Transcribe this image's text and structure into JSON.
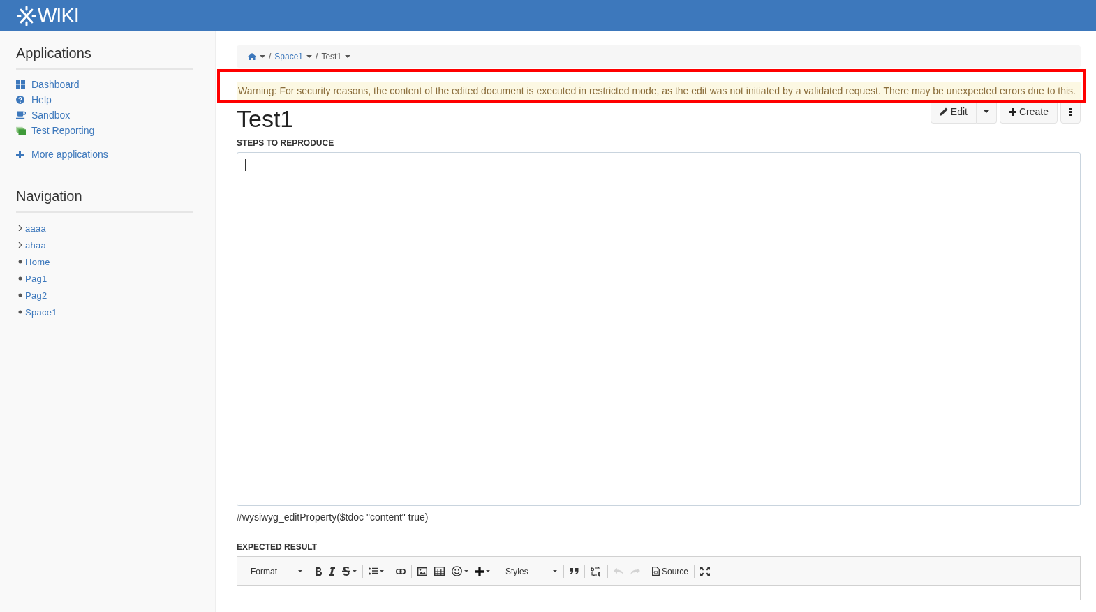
{
  "header": {
    "logo": "WIKI"
  },
  "sidebar": {
    "applications": {
      "title": "Applications",
      "items": [
        {
          "kind": "dashboard",
          "label": "Dashboard"
        },
        {
          "kind": "help",
          "label": "Help"
        },
        {
          "kind": "sandbox",
          "label": "Sandbox"
        },
        {
          "kind": "reporting",
          "label": "Test Reporting"
        }
      ],
      "more": "More applications"
    },
    "navigation": {
      "title": "Navigation",
      "items": [
        {
          "label": "aaaa",
          "expandable": true
        },
        {
          "label": "ahaa",
          "expandable": true
        },
        {
          "label": "Home",
          "expandable": false
        },
        {
          "label": "Pag1",
          "expandable": false
        },
        {
          "label": "Pag2",
          "expandable": false
        },
        {
          "label": "Space1",
          "expandable": false
        }
      ]
    }
  },
  "breadcrumb": [
    {
      "kind": "home"
    },
    {
      "kind": "separator",
      "label": "/"
    },
    {
      "kind": "link",
      "label": "Space1"
    },
    {
      "kind": "separator",
      "label": "/"
    },
    {
      "kind": "current",
      "label": "Test1"
    }
  ],
  "warning": "Warning: For security reasons, the content of the edited document is executed in restricted mode, as the edit was not initiated by a validated request. There may be unexpected errors due to this.",
  "page_title": "Test1",
  "actions": {
    "edit": "Edit",
    "create": "Create"
  },
  "fields": [
    {
      "label": "STEPS TO REPRODUCE"
    }
  ],
  "macro_text": "#wysiwyg_editProperty($tdoc \"content\" true)",
  "expected": {
    "label": "EXPECTED RESULT",
    "toolbar": [
      {
        "kind": "dropdown",
        "label": "Format",
        "caret": true,
        "disabled": false
      },
      {
        "kind": "sep"
      },
      {
        "kind": "bold",
        "caret": false,
        "disabled": false
      },
      {
        "kind": "italic",
        "caret": false,
        "disabled": false
      },
      {
        "kind": "strike",
        "caret": true,
        "disabled": false
      },
      {
        "kind": "sep"
      },
      {
        "kind": "list",
        "caret": true,
        "disabled": false
      },
      {
        "kind": "sep"
      },
      {
        "kind": "link",
        "caret": false,
        "disabled": false
      },
      {
        "kind": "sep"
      },
      {
        "kind": "image",
        "caret": false,
        "disabled": false
      },
      {
        "kind": "table",
        "caret": false,
        "disabled": false
      },
      {
        "kind": "emoji",
        "caret": true,
        "disabled": false
      },
      {
        "kind": "plus",
        "caret": true,
        "disabled": false
      },
      {
        "kind": "sep"
      },
      {
        "kind": "dropdown",
        "label": "Styles",
        "caret": true,
        "disabled": false
      },
      {
        "kind": "sep"
      },
      {
        "kind": "quote",
        "caret": false,
        "disabled": false
      },
      {
        "kind": "sep"
      },
      {
        "kind": "replace",
        "caret": false,
        "disabled": false
      },
      {
        "kind": "sep"
      },
      {
        "kind": "undo",
        "caret": false,
        "disabled": true
      },
      {
        "kind": "redo",
        "caret": false,
        "disabled": true
      },
      {
        "kind": "sep"
      },
      {
        "kind": "source",
        "label": "Source",
        "caret": false,
        "disabled": false
      },
      {
        "kind": "sep"
      },
      {
        "kind": "maximize",
        "caret": false,
        "disabled": false
      },
      {
        "kind": "sep"
      }
    ]
  }
}
